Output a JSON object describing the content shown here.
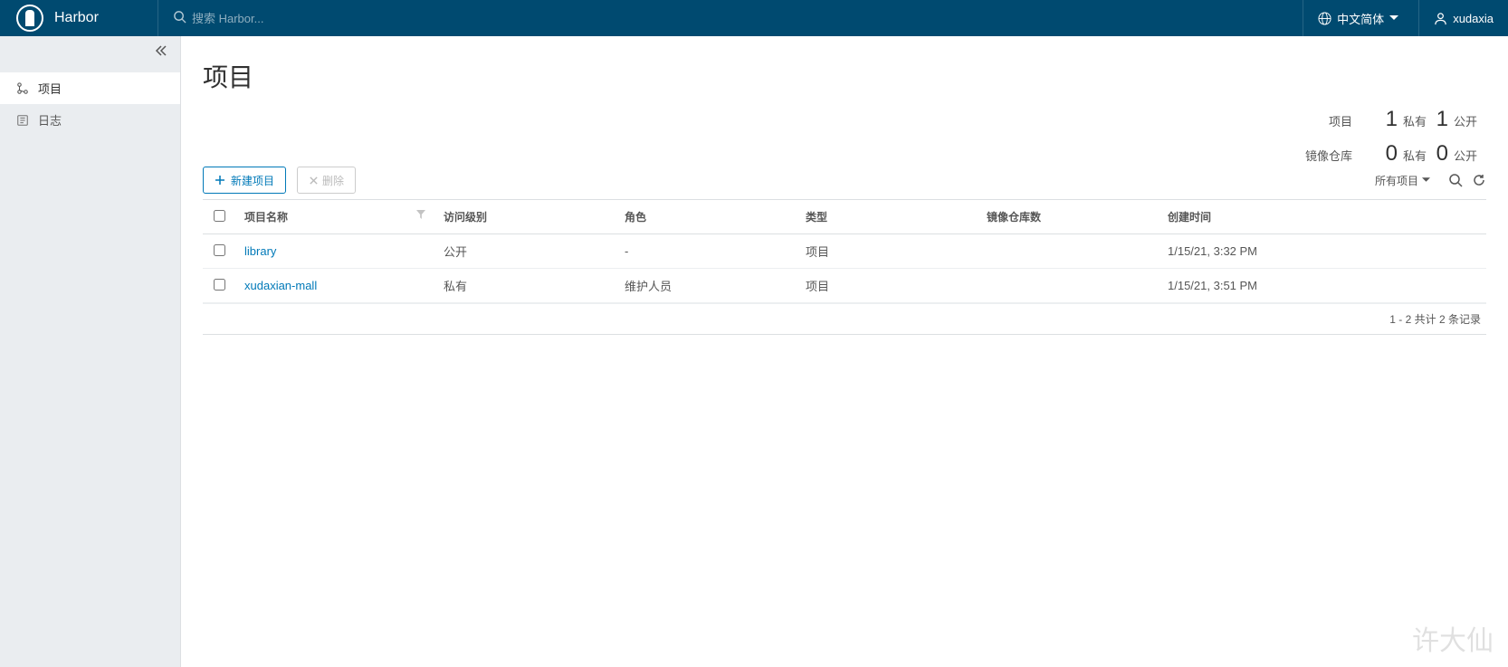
{
  "header": {
    "brand": "Harbor",
    "search_placeholder": "搜索 Harbor...",
    "language": "中文简体",
    "user": "xudaxia"
  },
  "sidebar": {
    "items": [
      {
        "label": "项目",
        "active": true
      },
      {
        "label": "日志",
        "active": false
      }
    ]
  },
  "page": {
    "title": "项目"
  },
  "stats": {
    "row1_label": "项目",
    "row1_private_count": "1",
    "row1_private_label": "私有",
    "row1_public_count": "1",
    "row1_public_label": "公开",
    "row2_label": "镜像仓库",
    "row2_private_count": "0",
    "row2_private_label": "私有",
    "row2_public_count": "0",
    "row2_public_label": "公开"
  },
  "toolbar": {
    "new_project": "新建项目",
    "delete": "删除",
    "filter": "所有项目"
  },
  "table": {
    "headers": {
      "name": "项目名称",
      "access": "访问级别",
      "role": "角色",
      "type": "类型",
      "repo_count": "镜像仓库数",
      "created": "创建时间"
    },
    "rows": [
      {
        "name": "library",
        "access": "公开",
        "role": "-",
        "type": "项目",
        "repo_count": "",
        "created": "1/15/21, 3:32 PM"
      },
      {
        "name": "xudaxian-mall",
        "access": "私有",
        "role": "维护人员",
        "type": "项目",
        "repo_count": "",
        "created": "1/15/21, 3:51 PM"
      }
    ],
    "footer": "1 - 2 共计 2 条记录"
  },
  "watermark": "许大仙"
}
